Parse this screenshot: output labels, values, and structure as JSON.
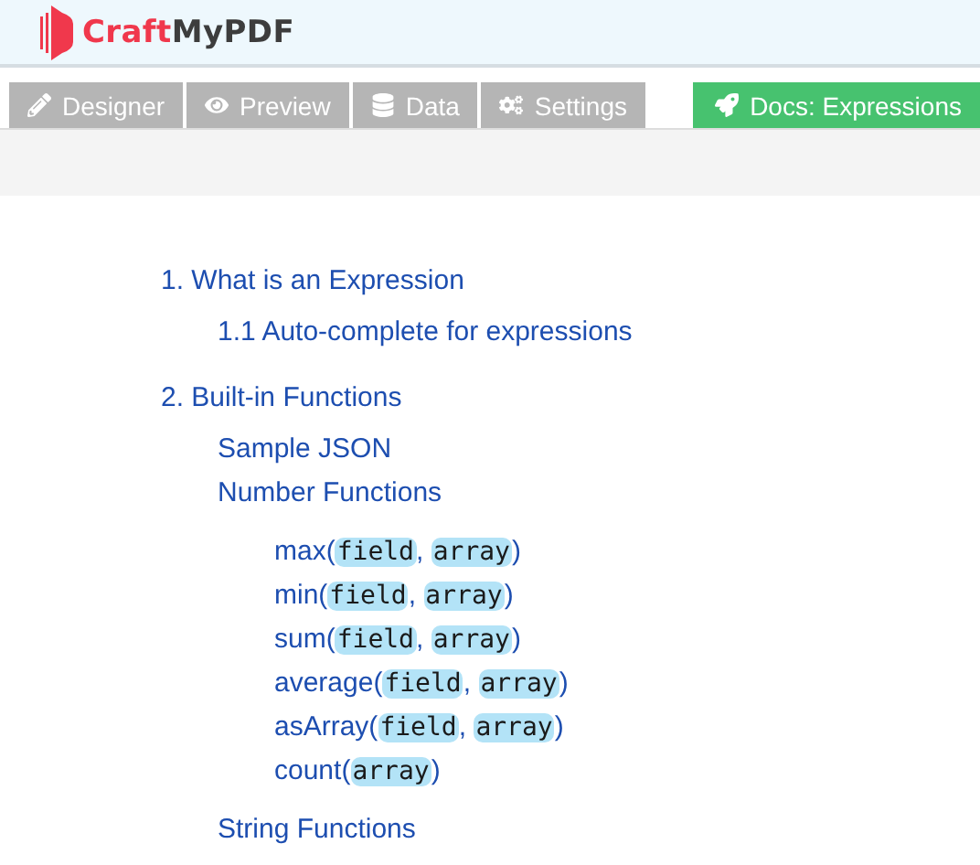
{
  "logo": {
    "part_1": "Craft",
    "part_2": "MyPDF"
  },
  "tabs": [
    {
      "label": "Designer"
    },
    {
      "label": "Preview"
    },
    {
      "label": "Data"
    },
    {
      "label": "Settings"
    }
  ],
  "docs_button": {
    "label": "Docs: Expressions"
  },
  "toc": [
    {
      "text": "1. What is an Expression",
      "children": [
        {
          "text": "1.1 Auto-complete for expressions"
        }
      ]
    },
    {
      "text": "2. Built-in Functions",
      "children": [
        {
          "text": "Sample JSON"
        },
        {
          "text": "Number Functions",
          "children": [
            {
              "parts": [
                {
                  "kind": "text",
                  "text": "max("
                },
                {
                  "kind": "code",
                  "text": "field"
                },
                {
                  "kind": "text",
                  "text": ", "
                },
                {
                  "kind": "code",
                  "text": "array"
                },
                {
                  "kind": "text",
                  "text": ")"
                }
              ]
            },
            {
              "parts": [
                {
                  "kind": "text",
                  "text": "min("
                },
                {
                  "kind": "code",
                  "text": "field"
                },
                {
                  "kind": "text",
                  "text": ", "
                },
                {
                  "kind": "code",
                  "text": "array"
                },
                {
                  "kind": "text",
                  "text": ")"
                }
              ]
            },
            {
              "parts": [
                {
                  "kind": "text",
                  "text": "sum("
                },
                {
                  "kind": "code",
                  "text": "field"
                },
                {
                  "kind": "text",
                  "text": ", "
                },
                {
                  "kind": "code",
                  "text": "array"
                },
                {
                  "kind": "text",
                  "text": ")"
                }
              ]
            },
            {
              "parts": [
                {
                  "kind": "text",
                  "text": "average("
                },
                {
                  "kind": "code",
                  "text": "field"
                },
                {
                  "kind": "text",
                  "text": ", "
                },
                {
                  "kind": "code",
                  "text": "array"
                },
                {
                  "kind": "text",
                  "text": ")"
                }
              ]
            },
            {
              "parts": [
                {
                  "kind": "text",
                  "text": "asArray("
                },
                {
                  "kind": "code",
                  "text": "field"
                },
                {
                  "kind": "text",
                  "text": ", "
                },
                {
                  "kind": "code",
                  "text": "array"
                },
                {
                  "kind": "text",
                  "text": ")"
                }
              ]
            },
            {
              "parts": [
                {
                  "kind": "text",
                  "text": "count("
                },
                {
                  "kind": "code",
                  "text": "array"
                },
                {
                  "kind": "text",
                  "text": ")"
                }
              ]
            }
          ]
        },
        {
          "text": "String Functions"
        }
      ]
    }
  ]
}
